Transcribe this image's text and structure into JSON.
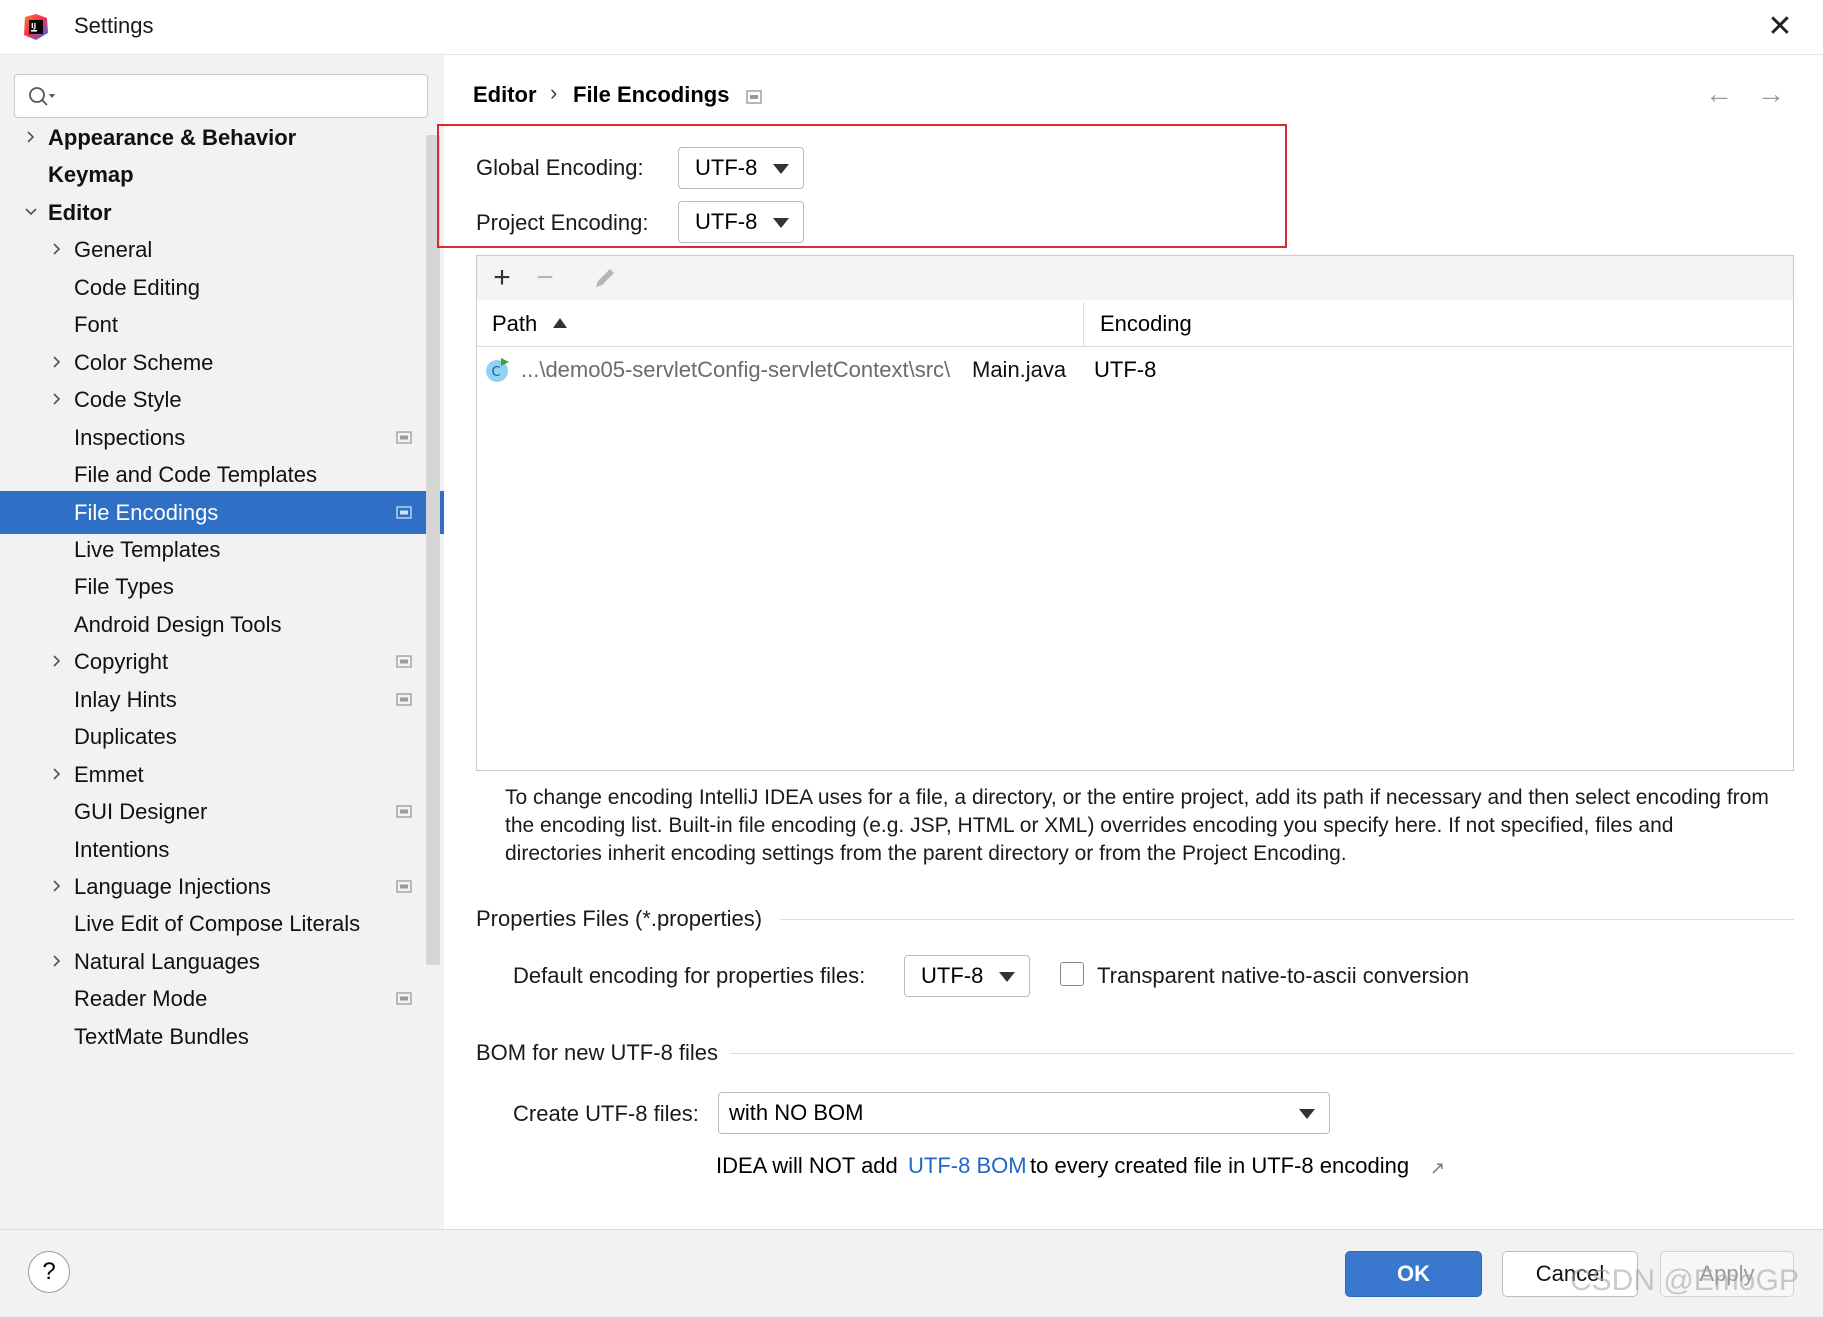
{
  "window": {
    "title": "Settings",
    "close_glyph": "✕"
  },
  "sidebar": {
    "search": {
      "value": "",
      "placeholder": ""
    },
    "items": [
      {
        "label": "Appearance & Behavior",
        "level": 0,
        "bold": true,
        "expandable": true,
        "expanded": false,
        "project_icon": false,
        "selected": false
      },
      {
        "label": "Keymap",
        "level": 0,
        "bold": true,
        "expandable": false,
        "expanded": false,
        "project_icon": false,
        "selected": false
      },
      {
        "label": "Editor",
        "level": 0,
        "bold": true,
        "expandable": true,
        "expanded": true,
        "project_icon": false,
        "selected": false
      },
      {
        "label": "General",
        "level": 1,
        "bold": false,
        "expandable": true,
        "expanded": false,
        "project_icon": false,
        "selected": false
      },
      {
        "label": "Code Editing",
        "level": 1,
        "bold": false,
        "expandable": false,
        "expanded": false,
        "project_icon": false,
        "selected": false
      },
      {
        "label": "Font",
        "level": 1,
        "bold": false,
        "expandable": false,
        "expanded": false,
        "project_icon": false,
        "selected": false
      },
      {
        "label": "Color Scheme",
        "level": 1,
        "bold": false,
        "expandable": true,
        "expanded": false,
        "project_icon": false,
        "selected": false
      },
      {
        "label": "Code Style",
        "level": 1,
        "bold": false,
        "expandable": true,
        "expanded": false,
        "project_icon": false,
        "selected": false
      },
      {
        "label": "Inspections",
        "level": 1,
        "bold": false,
        "expandable": false,
        "expanded": false,
        "project_icon": true,
        "selected": false
      },
      {
        "label": "File and Code Templates",
        "level": 1,
        "bold": false,
        "expandable": false,
        "expanded": false,
        "project_icon": false,
        "selected": false
      },
      {
        "label": "File Encodings",
        "level": 1,
        "bold": false,
        "expandable": false,
        "expanded": false,
        "project_icon": true,
        "selected": true
      },
      {
        "label": "Live Templates",
        "level": 1,
        "bold": false,
        "expandable": false,
        "expanded": false,
        "project_icon": false,
        "selected": false
      },
      {
        "label": "File Types",
        "level": 1,
        "bold": false,
        "expandable": false,
        "expanded": false,
        "project_icon": false,
        "selected": false
      },
      {
        "label": "Android Design Tools",
        "level": 1,
        "bold": false,
        "expandable": false,
        "expanded": false,
        "project_icon": false,
        "selected": false
      },
      {
        "label": "Copyright",
        "level": 1,
        "bold": false,
        "expandable": true,
        "expanded": false,
        "project_icon": true,
        "selected": false
      },
      {
        "label": "Inlay Hints",
        "level": 1,
        "bold": false,
        "expandable": false,
        "expanded": false,
        "project_icon": true,
        "selected": false
      },
      {
        "label": "Duplicates",
        "level": 1,
        "bold": false,
        "expandable": false,
        "expanded": false,
        "project_icon": false,
        "selected": false
      },
      {
        "label": "Emmet",
        "level": 1,
        "bold": false,
        "expandable": true,
        "expanded": false,
        "project_icon": false,
        "selected": false
      },
      {
        "label": "GUI Designer",
        "level": 1,
        "bold": false,
        "expandable": false,
        "expanded": false,
        "project_icon": true,
        "selected": false
      },
      {
        "label": "Intentions",
        "level": 1,
        "bold": false,
        "expandable": false,
        "expanded": false,
        "project_icon": false,
        "selected": false
      },
      {
        "label": "Language Injections",
        "level": 1,
        "bold": false,
        "expandable": true,
        "expanded": false,
        "project_icon": true,
        "selected": false
      },
      {
        "label": "Live Edit of Compose Literals",
        "level": 1,
        "bold": false,
        "expandable": false,
        "expanded": false,
        "project_icon": false,
        "selected": false
      },
      {
        "label": "Natural Languages",
        "level": 1,
        "bold": false,
        "expandable": true,
        "expanded": false,
        "project_icon": false,
        "selected": false
      },
      {
        "label": "Reader Mode",
        "level": 1,
        "bold": false,
        "expandable": false,
        "expanded": false,
        "project_icon": true,
        "selected": false
      },
      {
        "label": "TextMate Bundles",
        "level": 1,
        "bold": false,
        "expandable": false,
        "expanded": false,
        "project_icon": false,
        "selected": false
      }
    ]
  },
  "breadcrumb": {
    "parent": "Editor",
    "separator": "›",
    "current": "File Encodings"
  },
  "nav": {
    "back_glyph": "←",
    "forward_glyph": "→"
  },
  "encodings": {
    "global_label": "Global Encoding:",
    "global_value": "UTF-8",
    "project_label": "Project Encoding:",
    "project_value": "UTF-8"
  },
  "table": {
    "toolbar": {
      "add": "+",
      "remove": "−"
    },
    "columns": {
      "path": "Path",
      "encoding": "Encoding"
    },
    "rows": [
      {
        "path_prefix": "...\\demo05-servletConfig-servletContext\\src\\",
        "path_file": "Main.java",
        "encoding": "UTF-8"
      }
    ]
  },
  "help_text": "To change encoding IntelliJ IDEA uses for a file, a directory, or the entire project, add its path if necessary and then select encoding from the encoding list. Built-in file encoding (e.g. JSP, HTML or XML) overrides encoding you specify here. If not specified, files and directories inherit encoding settings from the parent directory or from the Project Encoding.",
  "properties": {
    "section_title": "Properties Files (*.properties)",
    "default_label": "Default encoding for properties files:",
    "default_value": "UTF-8",
    "native_ascii_label": "Transparent native-to-ascii conversion",
    "native_ascii_checked": false
  },
  "bom": {
    "section_title": "BOM for new UTF-8 files",
    "create_label": "Create UTF-8 files:",
    "create_value": "with NO BOM",
    "note_pre": "IDEA will NOT add",
    "note_link": "UTF-8 BOM",
    "note_post": "to every created file in UTF-8 encoding",
    "ext_link_glyph": "↗"
  },
  "buttons": {
    "help": "?",
    "ok": "OK",
    "cancel": "Cancel",
    "apply": "Apply"
  },
  "watermark": "CSDN @EmoGP",
  "colors": {
    "selection": "#2f6fc6",
    "ok": "#3a78cf",
    "link": "#2166c9",
    "highlight_border": "#d92b2b"
  }
}
